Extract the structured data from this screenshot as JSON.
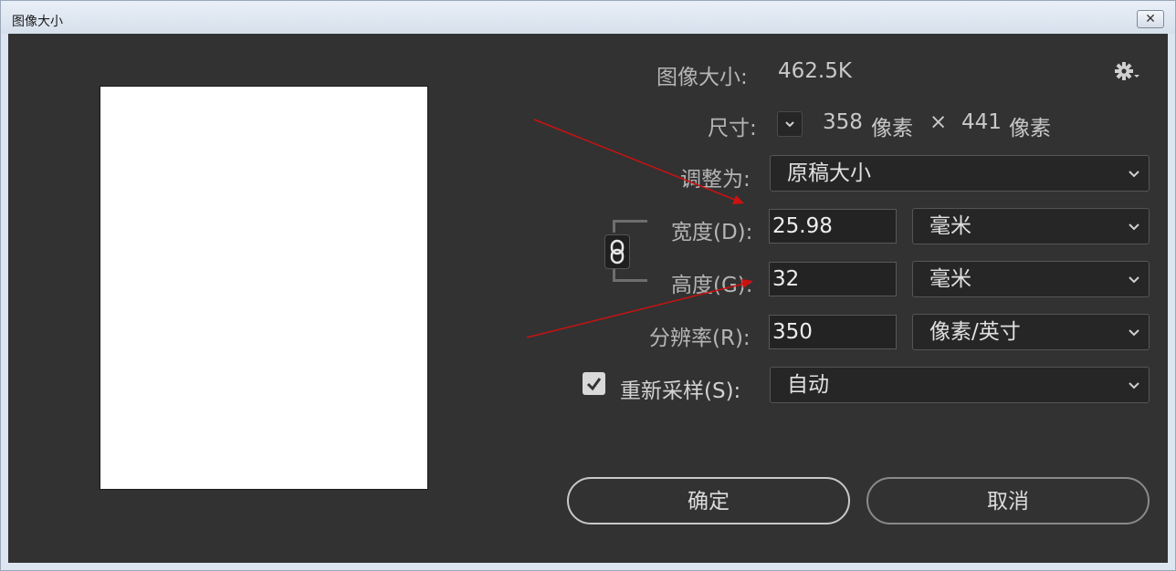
{
  "window": {
    "title": "图像大小",
    "close_glyph": "✕"
  },
  "header": {
    "image_size_label": "图像大小:",
    "image_size_value": "462.5K",
    "settings_icon": "gear-icon"
  },
  "dimensions": {
    "label": "尺寸:",
    "width_value": "358",
    "width_unit": "像素",
    "separator": "×",
    "height_value": "441",
    "height_unit": "像素"
  },
  "fit_to": {
    "label": "调整为:",
    "value": "原稿大小"
  },
  "width": {
    "label": "宽度(D):",
    "value": "25.98",
    "unit": "毫米"
  },
  "height": {
    "label": "高度(G):",
    "value": "32",
    "unit": "毫米"
  },
  "resolution": {
    "label": "分辨率(R):",
    "value": "350",
    "unit": "像素/英寸"
  },
  "resample": {
    "label": "重新采样(S):",
    "checked": true,
    "value": "自动"
  },
  "buttons": {
    "ok": "确定",
    "cancel": "取消"
  },
  "colors": {
    "dialog_bg": "#323232",
    "field_bg": "#262626",
    "annotation_arrow": "#cc1111"
  }
}
